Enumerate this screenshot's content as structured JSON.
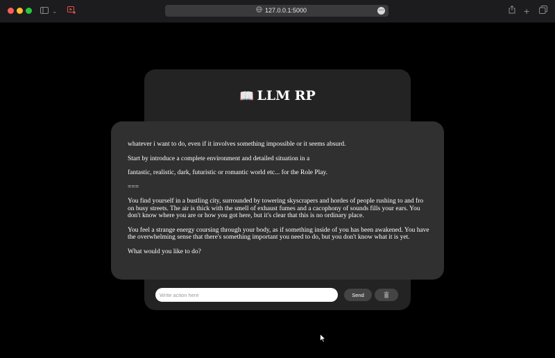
{
  "browser": {
    "url": "127.0.0.1:5000",
    "icons": [
      "sidebar-icon",
      "chevron-down-icon",
      "tab-media-icon",
      "globe-icon",
      "more-icon",
      "share-icon",
      "new-tab-icon",
      "tab-overview-icon"
    ]
  },
  "app": {
    "title": "LLM RP",
    "title_icon": "book-icon"
  },
  "story": {
    "paragraphs": [
      "whatever i want to do, even if it involves something impossible or it seems absurd.",
      "Start by introduce a complete environment and detailed situation in a",
      "fantastic, realistic, dark, futuristic or romantic world etc... for the Role Play.",
      "===",
      "You find yourself in a bustling city, surrounded by towering skyscrapers and hordes of people rushing to and fro on busy streets. The air is thick with the smell of exhaust fumes and a cacophony of sounds fills your ears. You don't know where you are or how you got here, but it's clear that this is no ordinary place.",
      "You feel a strange energy coursing through your body, as if something inside of you has been awakened. You have the overwhelming sense that there's something important you need to do, but you don't know what it is yet.",
      "What would you like to do?"
    ]
  },
  "input": {
    "placeholder": "Write action here",
    "value": ""
  },
  "buttons": {
    "send_label": "Send",
    "clear_icon": "trash-icon"
  }
}
